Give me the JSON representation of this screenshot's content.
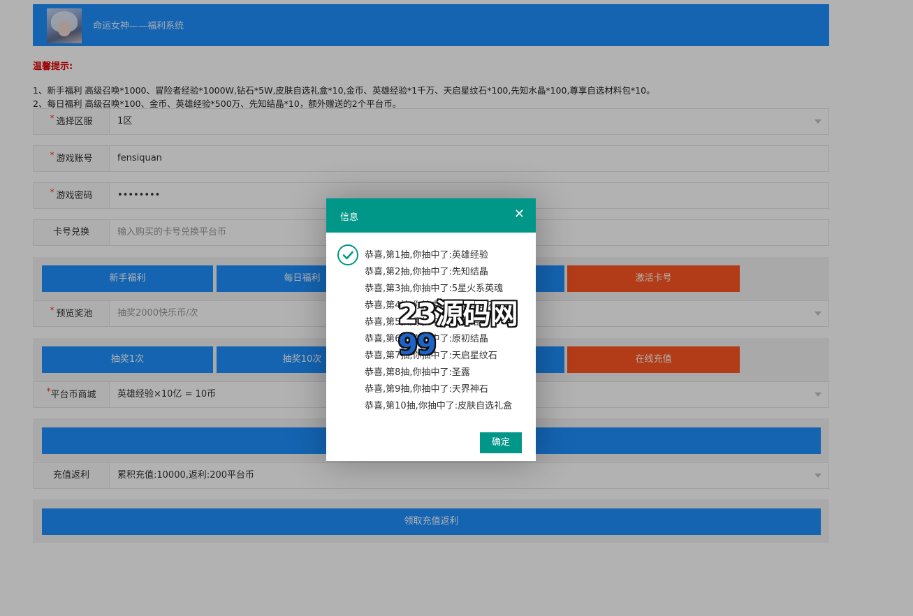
{
  "header": {
    "title": "命运女神——福利系统"
  },
  "tips": {
    "title": "温馨提示:",
    "lines": [
      "1、新手福利 高级召唤*1000、冒险者经验*1000W,钻石*5W,皮肤自选礼盒*10,金币、英雄经验*1千万、天启星纹石*100,先知水晶*100,尊享自选材料包*10。",
      "2、每日福利 高级召唤*100、金币、英雄经验*500万、先知结晶*10，额外赠送的2个平台币。"
    ]
  },
  "form": {
    "server": {
      "label": "选择区服",
      "value": "1区"
    },
    "account": {
      "label": "游戏账号",
      "value": "fensiquan"
    },
    "password": {
      "label": "游戏密码",
      "value": "••••••••"
    },
    "card": {
      "label": "卡号兑换",
      "placeholder": "输入购买的卡号兑换平台币"
    },
    "pool": {
      "label": "预览奖池",
      "placeholder": "抽奖2000快乐币/次"
    },
    "shop": {
      "label": "平台币商城",
      "value": "英雄经验×10亿 = 10币"
    },
    "rebate": {
      "label": "充值返利",
      "value": "累积充值:10000,返利:200平台币"
    }
  },
  "buttons": {
    "newbie": "新手福利",
    "daily": "每日福利",
    "activate": "激活卡号",
    "draw1": "抽奖1次",
    "draw10": "抽奖10次",
    "recharge": "在线充值",
    "claim_rebate": "领取充值返利"
  },
  "dialog": {
    "title": "信息",
    "lines": [
      "恭喜,第1抽,你抽中了:英雄经验",
      "恭喜,第2抽,你抽中了:先知结晶",
      "恭喜,第3抽,你抽中了:5星火系英魂",
      "恭喜,第4抽,你抽中了:天启星纹石",
      "恭喜,第5抽,你抽中了:原初结晶",
      "恭喜,第6抽,你抽中了:原初结晶",
      "恭喜,第7抽,你抽中了:天启星纹石",
      "恭喜,第8抽,你抽中了:圣露",
      "恭喜,第9抽,你抽中了:天界神石",
      "恭喜,第10抽,你抽中了:皮肤自选礼盒"
    ],
    "ok": "确定"
  },
  "watermark": {
    "text_a": "2",
    "text_b": "3源码网",
    "text_c": "99"
  },
  "colors": {
    "primary": "#1e90ff",
    "danger": "#ff5722",
    "dialog": "#009688"
  }
}
